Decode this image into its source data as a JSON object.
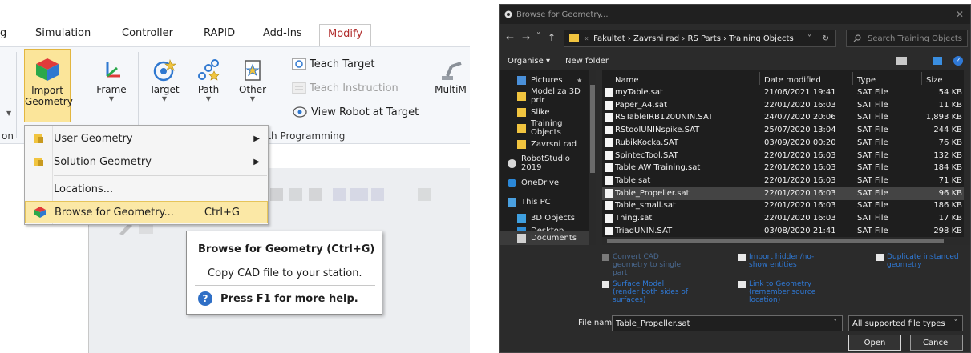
{
  "ribbon": {
    "tabs": [
      {
        "label": "g"
      },
      {
        "label": "Simulation"
      },
      {
        "label": "Controller"
      },
      {
        "label": "RAPID"
      },
      {
        "label": "Add-Ins"
      },
      {
        "label": "Modify"
      }
    ],
    "buttons": {
      "import_line1": "Import",
      "import_line2": "Geometry",
      "frame": "Frame",
      "target": "Target",
      "path": "Path",
      "other": "Other",
      "multi": "MultiM"
    },
    "small_buttons": {
      "teach_target": "Teach Target",
      "teach_instruction": "Teach Instruction",
      "view_robot": "View Robot at Target"
    },
    "group_labels": {
      "left": "on",
      "path_programming": "ath Programming"
    }
  },
  "menu": {
    "items": [
      {
        "label": "User Geometry"
      },
      {
        "label": "Solution Geometry"
      },
      {
        "label": "Locations..."
      },
      {
        "label": "Browse for Geometry...",
        "shortcut": "Ctrl+G"
      }
    ]
  },
  "tooltip": {
    "title": "Browse for Geometry (Ctrl+G)",
    "description": "Copy CAD file to your station.",
    "help": "Press F1 for more help.",
    "help_icon": "?"
  },
  "dialog": {
    "title": "Browse for Geometry...",
    "close": "✕",
    "nav": {
      "back": "←",
      "forward": "→",
      "recent": "˅",
      "up": "↑"
    },
    "breadcrumb": "Fakultet  ›  Zavrsni rad  ›  RS Parts  ›  Training Objects",
    "breadcrumb_prefix": "«",
    "addr_dropdown": "˅",
    "refresh": "↻",
    "search_placeholder": "Search Training Objects",
    "organise": "Organise ▾",
    "new_folder": "New folder",
    "help_icon": "?",
    "sidebar": [
      {
        "label": "Pictures",
        "pin": "📌",
        "color": "#4a90d9"
      },
      {
        "label": "Model za 3D prir",
        "color": "#f1c43f"
      },
      {
        "label": "Slike",
        "color": "#f1c43f"
      },
      {
        "label": "Training Objects",
        "color": "#f1c43f"
      },
      {
        "label": "Zavrsni rad",
        "color": "#f1c43f"
      },
      {
        "label": "RobotStudio 2019",
        "color": "#d8d8d8"
      },
      {
        "label": "OneDrive",
        "color": "#2b88d8"
      },
      {
        "label": "This PC",
        "color": "#4aa0e0"
      },
      {
        "label": "3D Objects",
        "color": "#3fa0e0"
      },
      {
        "label": "Desktop",
        "color": "#2f8fd8"
      },
      {
        "label": "Documents",
        "color": "#d0d0d0"
      }
    ],
    "columns": {
      "name": "Name",
      "date": "Date modified",
      "type": "Type",
      "size": "Size"
    },
    "files": [
      {
        "name": "myTable.sat",
        "date": "21/06/2021 19:41",
        "type": "SAT File",
        "size": "54 KB"
      },
      {
        "name": "Paper_A4.sat",
        "date": "22/01/2020 16:03",
        "type": "SAT File",
        "size": "11 KB"
      },
      {
        "name": "RSTableIRB120UNIN.SAT",
        "date": "24/07/2020 20:06",
        "type": "SAT File",
        "size": "1,893 KB"
      },
      {
        "name": "RStoolUNINspike.SAT",
        "date": "25/07/2020 13:04",
        "type": "SAT File",
        "size": "244 KB"
      },
      {
        "name": "RubikKocka.SAT",
        "date": "03/09/2020 00:20",
        "type": "SAT File",
        "size": "76 KB"
      },
      {
        "name": "SpintecTool.SAT",
        "date": "22/01/2020 16:03",
        "type": "SAT File",
        "size": "132 KB"
      },
      {
        "name": "Table AW Training.sat",
        "date": "22/01/2020 16:03",
        "type": "SAT File",
        "size": "184 KB"
      },
      {
        "name": "Table.sat",
        "date": "22/01/2020 16:03",
        "type": "SAT File",
        "size": "71 KB"
      },
      {
        "name": "Table_Propeller.sat",
        "date": "22/01/2020 16:03",
        "type": "SAT File",
        "size": "96 KB",
        "selected": true
      },
      {
        "name": "Table_small.sat",
        "date": "22/01/2020 16:03",
        "type": "SAT File",
        "size": "186 KB"
      },
      {
        "name": "Thing.sat",
        "date": "22/01/2020 16:03",
        "type": "SAT File",
        "size": "17 KB"
      },
      {
        "name": "TriadUNIN.SAT",
        "date": "03/08/2020 21:41",
        "type": "SAT File",
        "size": "298 KB"
      }
    ],
    "options": [
      {
        "label": "Convert CAD geometry to single part",
        "checked": false
      },
      {
        "label": "Import hidden/no-show entities",
        "checked": true
      },
      {
        "label": "Duplicate instanced geometry",
        "checked": true
      },
      {
        "label": "Surface Model (render both sides of surfaces)",
        "checked": true
      },
      {
        "label": "Link to Geometry (remember source location)",
        "checked": true
      }
    ],
    "file_name_label": "File name:",
    "file_name_value": "Table_Propeller.sat",
    "file_type": "All supported file types",
    "dropdown_arrow": "˅",
    "open": "Open",
    "cancel": "Cancel"
  }
}
